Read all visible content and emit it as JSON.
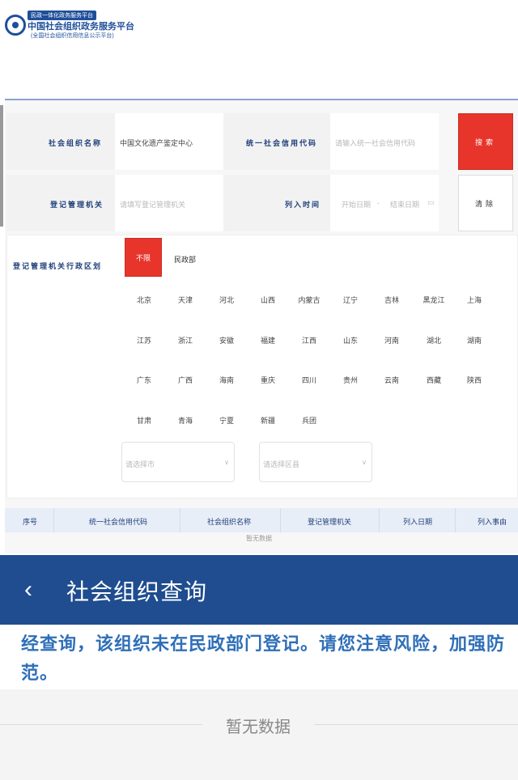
{
  "header": {
    "tag": "民政一体化政务服务平台",
    "title": "中国社会组织政务服务平台",
    "subtitle": "(全国社会组织信用信息公示平台)"
  },
  "form": {
    "org_name_label": "社会组织名称",
    "org_name_value": "中国文化遗产鉴定中心",
    "credit_code_label": "统一社会信用代码",
    "credit_code_placeholder": "请输入统一社会信用代码",
    "search_button": "搜索",
    "authority_label": "登记管理机关",
    "authority_placeholder": "请填写登记管理机关",
    "list_time_label": "列入时间",
    "start_date_placeholder": "开始日期",
    "date_sep": "-",
    "end_date_placeholder": "结束日期",
    "clear_button": "清除",
    "region_label": "登记管理机关行政区划",
    "all_button": "不限",
    "ministry_option": "民政部",
    "city_placeholder": "请选择市",
    "district_placeholder": "请选择区县"
  },
  "provinces": [
    [
      "北京",
      "天津",
      "河北",
      "山西",
      "内蒙古",
      "辽宁",
      "吉林",
      "黑龙江",
      "上海"
    ],
    [
      "江苏",
      "浙江",
      "安徽",
      "福建",
      "江西",
      "山东",
      "河南",
      "湖北",
      "湖南"
    ],
    [
      "广东",
      "广西",
      "海南",
      "重庆",
      "四川",
      "贵州",
      "云南",
      "西藏",
      "陕西"
    ],
    [
      "甘肃",
      "青海",
      "宁夏",
      "新疆",
      "兵团"
    ]
  ],
  "table": {
    "headers": [
      "序号",
      "统一社会信用代码",
      "社会组织名称",
      "登记管理机关",
      "列入日期",
      "列入事由"
    ],
    "empty_text": "暂无数据"
  },
  "overlay": {
    "back_icon": "chevron-left-icon",
    "title": "社会组织查询",
    "notice": "经查询，该组织未在民政部门登记。请您注意风险，加强防范。",
    "empty_text": "暂无数据"
  }
}
